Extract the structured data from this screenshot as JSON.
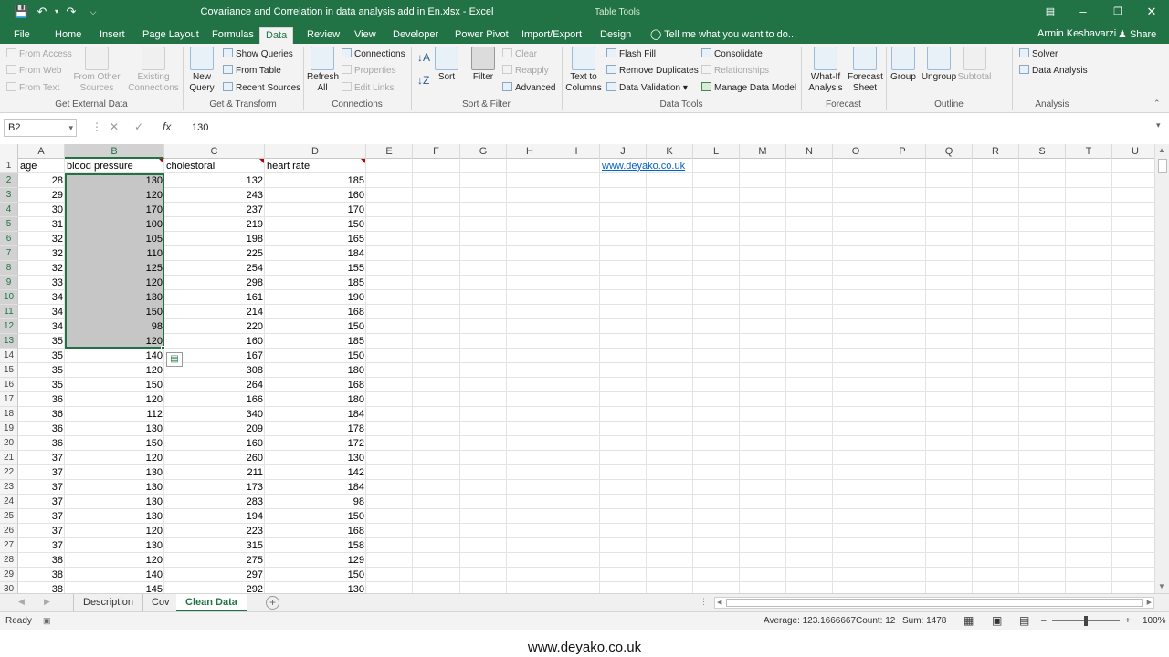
{
  "window": {
    "title": "Covariance and  Correlation in data analysis add in En.xlsx - Excel",
    "context_label": "Table Tools",
    "user": "Armin Keshavarzi",
    "share_label": "Share"
  },
  "tabs": [
    "File",
    "Home",
    "Insert",
    "Page Layout",
    "Formulas",
    "Data",
    "Review",
    "View",
    "Developer",
    "Power Pivot",
    "Import/Export",
    "Design"
  ],
  "active_tab": "Data",
  "tell_me": "Tell me what you want to do...",
  "ribbon": {
    "get_external": {
      "name": "Get External Data",
      "from_access": "From Access",
      "from_web": "From Web",
      "from_text": "From Text",
      "from_other": "From Other Sources",
      "existing": "Existing Connections"
    },
    "get_transform": {
      "name": "Get & Transform",
      "new_query": "New Query",
      "show_queries": "Show Queries",
      "from_table": "From Table",
      "recent_sources": "Recent Sources"
    },
    "connections": {
      "name": "Connections",
      "refresh_all": "Refresh All",
      "connections": "Connections",
      "properties": "Properties",
      "edit_links": "Edit Links"
    },
    "sort_filter": {
      "name": "Sort & Filter",
      "sort": "Sort",
      "filter": "Filter",
      "clear": "Clear",
      "reapply": "Reapply",
      "advanced": "Advanced"
    },
    "data_tools": {
      "name": "Data Tools",
      "text_to_columns": "Text to Columns",
      "flash_fill": "Flash Fill",
      "remove_duplicates": "Remove Duplicates",
      "data_validation": "Data Validation",
      "consolidate": "Consolidate",
      "relationships": "Relationships",
      "manage_model": "Manage Data Model"
    },
    "forecast": {
      "name": "Forecast",
      "what_if": "What-If Analysis",
      "forecast_sheet": "Forecast Sheet"
    },
    "outline": {
      "name": "Outline",
      "group": "Group",
      "ungroup": "Ungroup",
      "subtotal": "Subtotal"
    },
    "analysis": {
      "name": "Analysis",
      "solver": "Solver",
      "data_analysis": "Data Analysis"
    }
  },
  "formula_bar": {
    "name_box": "B2",
    "formula": "130"
  },
  "columns": [
    "A",
    "B",
    "C",
    "D",
    "E",
    "F",
    "G",
    "H",
    "I",
    "J",
    "K",
    "L",
    "M",
    "N",
    "O",
    "P",
    "Q",
    "R",
    "S",
    "T",
    "U"
  ],
  "selected_column": "B",
  "headers": {
    "age": "age",
    "bp": "blood pressure",
    "chol": "cholestoral",
    "hr": "heart rate",
    "link": "www.deyako.co.uk"
  },
  "rows": [
    {
      "n": "2",
      "a": "28",
      "b": "130",
      "c": "132",
      "d": "185"
    },
    {
      "n": "3",
      "a": "29",
      "b": "120",
      "c": "243",
      "d": "160"
    },
    {
      "n": "4",
      "a": "30",
      "b": "170",
      "c": "237",
      "d": "170"
    },
    {
      "n": "5",
      "a": "31",
      "b": "100",
      "c": "219",
      "d": "150"
    },
    {
      "n": "6",
      "a": "32",
      "b": "105",
      "c": "198",
      "d": "165"
    },
    {
      "n": "7",
      "a": "32",
      "b": "110",
      "c": "225",
      "d": "184"
    },
    {
      "n": "8",
      "a": "32",
      "b": "125",
      "c": "254",
      "d": "155"
    },
    {
      "n": "9",
      "a": "33",
      "b": "120",
      "c": "298",
      "d": "185"
    },
    {
      "n": "10",
      "a": "34",
      "b": "130",
      "c": "161",
      "d": "190"
    },
    {
      "n": "11",
      "a": "34",
      "b": "150",
      "c": "214",
      "d": "168"
    },
    {
      "n": "12",
      "a": "34",
      "b": "98",
      "c": "220",
      "d": "150"
    },
    {
      "n": "13",
      "a": "35",
      "b": "120",
      "c": "160",
      "d": "185"
    },
    {
      "n": "14",
      "a": "35",
      "b": "140",
      "c": "167",
      "d": "150"
    },
    {
      "n": "15",
      "a": "35",
      "b": "120",
      "c": "308",
      "d": "180"
    },
    {
      "n": "16",
      "a": "35",
      "b": "150",
      "c": "264",
      "d": "168"
    },
    {
      "n": "17",
      "a": "36",
      "b": "120",
      "c": "166",
      "d": "180"
    },
    {
      "n": "18",
      "a": "36",
      "b": "112",
      "c": "340",
      "d": "184"
    },
    {
      "n": "19",
      "a": "36",
      "b": "130",
      "c": "209",
      "d": "178"
    },
    {
      "n": "20",
      "a": "36",
      "b": "150",
      "c": "160",
      "d": "172"
    },
    {
      "n": "21",
      "a": "37",
      "b": "120",
      "c": "260",
      "d": "130"
    },
    {
      "n": "22",
      "a": "37",
      "b": "130",
      "c": "211",
      "d": "142"
    },
    {
      "n": "23",
      "a": "37",
      "b": "130",
      "c": "173",
      "d": "184"
    },
    {
      "n": "24",
      "a": "37",
      "b": "130",
      "c": "283",
      "d": "98"
    },
    {
      "n": "25",
      "a": "37",
      "b": "130",
      "c": "194",
      "d": "150"
    },
    {
      "n": "26",
      "a": "37",
      "b": "120",
      "c": "223",
      "d": "168"
    },
    {
      "n": "27",
      "a": "37",
      "b": "130",
      "c": "315",
      "d": "158"
    },
    {
      "n": "28",
      "a": "38",
      "b": "120",
      "c": "275",
      "d": "129"
    },
    {
      "n": "29",
      "a": "38",
      "b": "140",
      "c": "297",
      "d": "150"
    },
    {
      "n": "30",
      "a": "38",
      "b": "145",
      "c": "292",
      "d": "130"
    }
  ],
  "sheets": [
    "Description",
    "Cov",
    "Clean Data"
  ],
  "active_sheet": "Clean Data",
  "status": {
    "ready": "Ready",
    "average": "Average: 123.1666667",
    "count": "Count: 12",
    "sum": "Sum: 1478",
    "zoom": "100%"
  },
  "footer": "www.deyako.co.uk",
  "colors": {
    "excel_green": "#217346",
    "selection": "#c6c6c6",
    "link": "#0563c1"
  }
}
